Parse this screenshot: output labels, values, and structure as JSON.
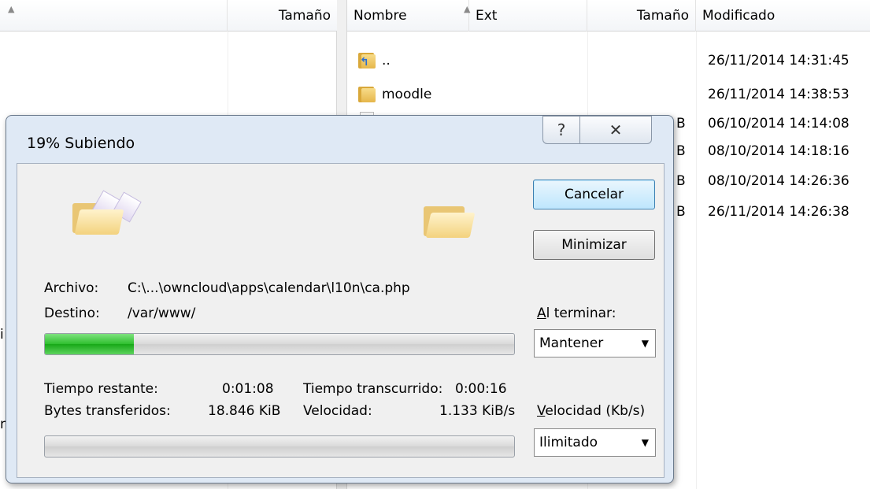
{
  "left_panel": {
    "columns": {
      "size": "Tamaño"
    },
    "partial_chars": [
      "i",
      "n"
    ]
  },
  "right_panel": {
    "columns": {
      "name": "Nombre",
      "ext": "Ext",
      "size": "Tamaño",
      "modified": "Modificado"
    },
    "rows": [
      {
        "name": "..",
        "size": "",
        "modified": "26/11/2014 14:31:45",
        "icon": "folder-up-icon"
      },
      {
        "name": "moodle",
        "size": "",
        "modified": "26/11/2014 14:38:53",
        "icon": "folder-icon"
      },
      {
        "name": "",
        "size": "B",
        "modified": "06/10/2014 14:14:08",
        "icon": "file-icon"
      },
      {
        "name": "",
        "size": "B",
        "modified": "08/10/2014 14:18:16",
        "icon": "file-icon"
      },
      {
        "name": "",
        "size": "B",
        "modified": "08/10/2014 14:26:36",
        "icon": "file-icon"
      },
      {
        "name": "",
        "size": "B",
        "modified": "26/11/2014 14:26:38",
        "icon": "file-icon"
      }
    ]
  },
  "dialog": {
    "title": "19% Subiendo",
    "help_glyph": "?",
    "close_glyph": "✕",
    "file_label": "Archivo:",
    "file_value": "C:\\...\\owncloud\\apps\\calendar\\l10n\\ca.php",
    "dest_label": "Destino:",
    "dest_value": "/var/www/",
    "cancel_label": "Cancelar",
    "minimize_label": "Minimizar",
    "on_finish_label_accel": "A",
    "on_finish_label_rest": "l terminar:",
    "on_finish_value": "Mantener",
    "file_progress": 0.19,
    "time_remaining_label": "Tiempo restante:",
    "time_remaining_value": "0:01:08",
    "time_elapsed_label": "Tiempo transcurrido:",
    "time_elapsed_value": "0:00:16",
    "bytes_label": "Bytes transferidos:",
    "bytes_value": "18.846 KiB",
    "speed_label": "Velocidad:",
    "speed_value": "1.133 KiB/s",
    "speed_limit_label_accel": "V",
    "speed_limit_label_rest": "elocidad (Kb/s)",
    "speed_limit_value": "Ilimitado",
    "total_progress": 0
  }
}
